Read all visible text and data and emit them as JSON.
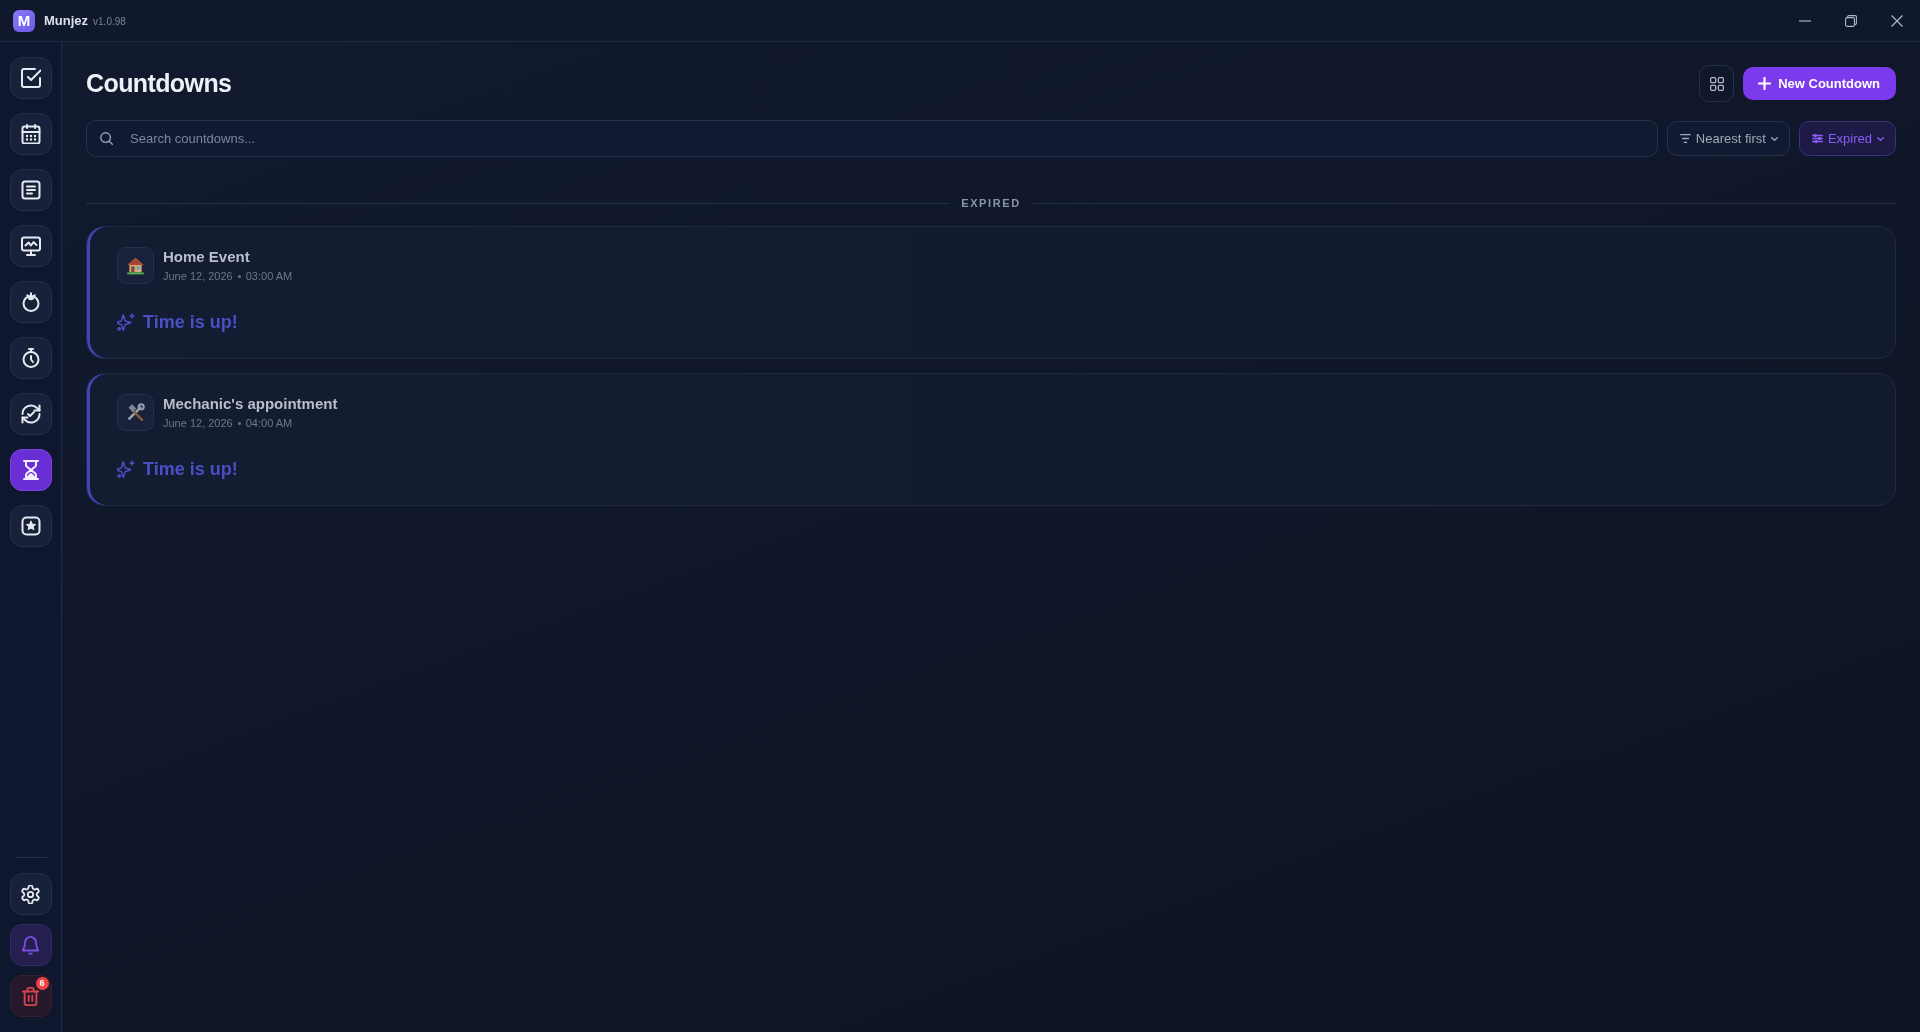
{
  "app": {
    "logo_letter": "M",
    "name": "Munjez",
    "version": "v1.0.98"
  },
  "sidebar": {
    "items": [
      {
        "kind": "check",
        "selected": false
      },
      {
        "kind": "calendar",
        "selected": false
      },
      {
        "kind": "document",
        "selected": false
      },
      {
        "kind": "monitor",
        "selected": false
      },
      {
        "kind": "tomato",
        "selected": false
      },
      {
        "kind": "stopwatch",
        "selected": false
      },
      {
        "kind": "cycle",
        "selected": false
      },
      {
        "kind": "hourglass",
        "selected": true
      },
      {
        "kind": "star",
        "selected": false
      }
    ],
    "bottom_items": [
      {
        "kind": "settings"
      },
      {
        "kind": "bell"
      },
      {
        "kind": "trash",
        "badge": "6"
      }
    ]
  },
  "header": {
    "title": "Countdowns",
    "primary_button": "New Countdown"
  },
  "search": {
    "placeholder": "Search countdowns..."
  },
  "filters": [
    {
      "kind": "sort",
      "label": "Nearest first",
      "active": false
    },
    {
      "kind": "filter",
      "label": "Expired",
      "active": true
    }
  ],
  "section": {
    "title": "EXPIRED"
  },
  "countdowns": [
    {
      "kind": "house",
      "title": "Home Event",
      "date": "June 12, 2026",
      "time": "03:00 AM",
      "status": "Time is up!"
    },
    {
      "kind": "tools",
      "title": "Mechanic's appointment",
      "date": "June 12, 2026",
      "time": "04:00 AM",
      "status": "Time is up!"
    }
  ]
}
